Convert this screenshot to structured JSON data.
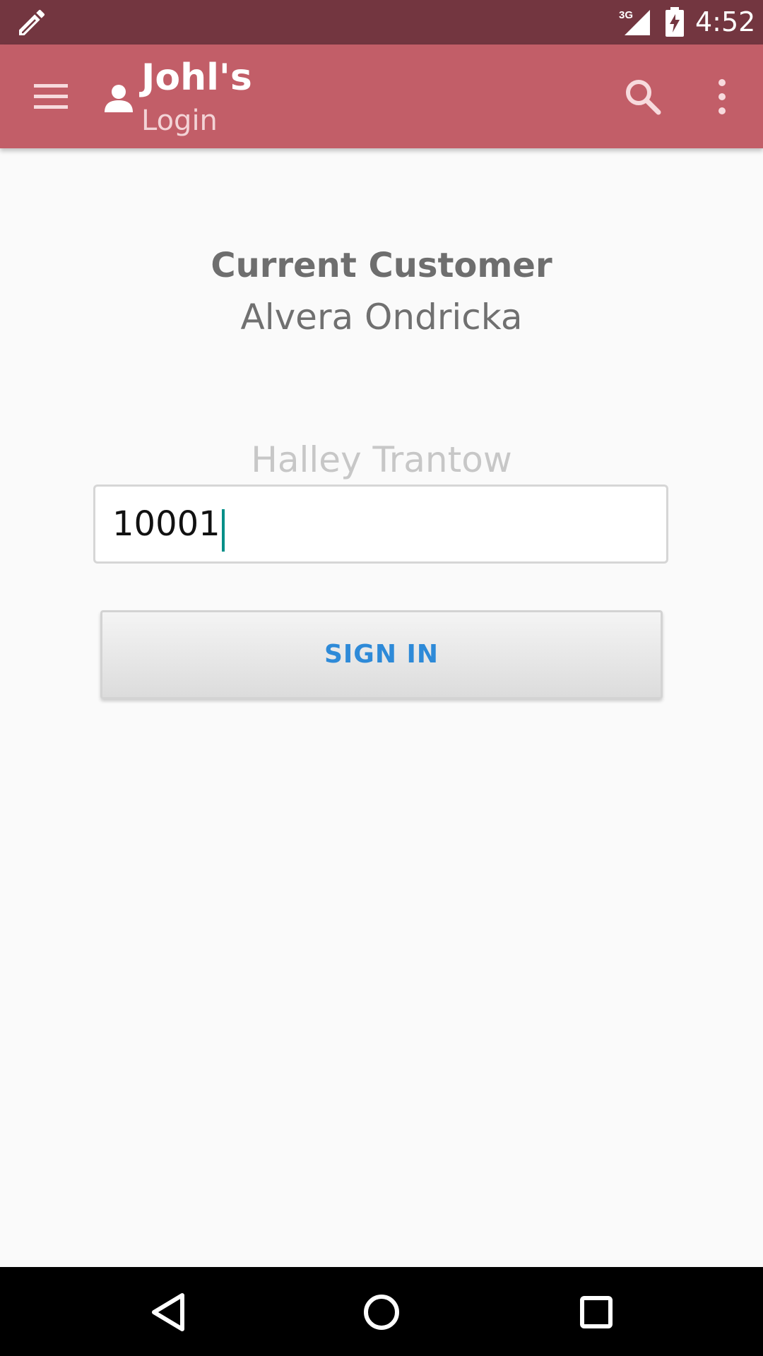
{
  "status_bar": {
    "time": "4:52",
    "network": "3G",
    "notification_icon": "pencil-icon",
    "signal_icon": "signal-icon",
    "battery_icon": "battery-icon"
  },
  "app_bar": {
    "title": "Johl's",
    "subtitle": "Login",
    "menu_icon": "menu-icon",
    "user_icon": "person-icon",
    "search_icon": "search-icon",
    "overflow_icon": "overflow-menu-icon",
    "background": "#c25e68"
  },
  "content": {
    "current_customer_label": "Current Customer",
    "current_customer_name": "Alvera Ondricka",
    "hint_customer_name": "Halley Trantow",
    "customer_id_value": "10001",
    "sign_in_label": "SIGN IN"
  },
  "nav_bar": {
    "back_icon": "back-icon",
    "home_icon": "home-icon",
    "recents_icon": "recents-icon"
  },
  "colors": {
    "status_bar": "#733640",
    "accent": "#2e8ad8",
    "caret": "#008f88"
  }
}
